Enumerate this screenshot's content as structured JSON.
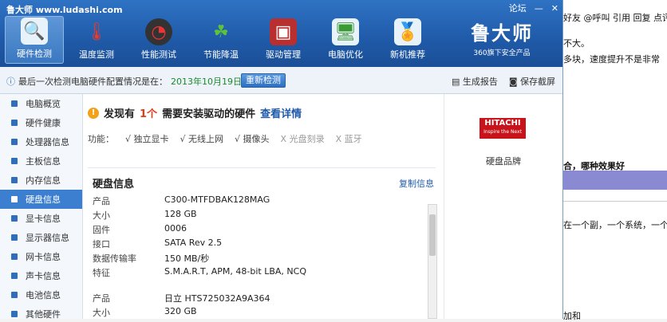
{
  "window": {
    "title": "鲁大师 www.ludashi.com",
    "forum_label": "论坛"
  },
  "toolbar": {
    "items": [
      {
        "label": "硬件检测",
        "icon": "monitor-magnifier-icon"
      },
      {
        "label": "温度监测",
        "icon": "thermometer-icon"
      },
      {
        "label": "性能测试",
        "icon": "speedometer-icon"
      },
      {
        "label": "节能降温",
        "icon": "clover-icon"
      },
      {
        "label": "驱动管理",
        "icon": "driver-box-icon"
      },
      {
        "label": "电脑优化",
        "icon": "monitor-broom-icon"
      },
      {
        "label": "新机推荐",
        "icon": "monitor-badge-icon"
      }
    ]
  },
  "brand": {
    "logo": "鲁大师",
    "slogan": "360旗下安全产品"
  },
  "status": {
    "text": "最后一次检测电脑硬件配置情况是在：",
    "date": "2013年10月19日",
    "recheck_label": "重新检测",
    "report_label": "生成报告",
    "screenshot_label": "保存截屏"
  },
  "sidebar": {
    "items": [
      {
        "label": "电脑概览"
      },
      {
        "label": "硬件健康"
      },
      {
        "label": "处理器信息"
      },
      {
        "label": "主板信息"
      },
      {
        "label": "内存信息"
      },
      {
        "label": "硬盘信息"
      },
      {
        "label": "显卡信息"
      },
      {
        "label": "显示器信息"
      },
      {
        "label": "网卡信息"
      },
      {
        "label": "声卡信息"
      },
      {
        "label": "电池信息"
      },
      {
        "label": "其他硬件"
      }
    ],
    "active_index": 5
  },
  "main": {
    "alert_prefix": "发现有",
    "alert_count": "1个",
    "alert_suffix": "需要安装驱动的硬件",
    "alert_link": "查看详情",
    "features_label": "功能：",
    "features": [
      {
        "label": "√ 独立显卡",
        "enabled": true
      },
      {
        "label": "√ 无线上网",
        "enabled": true
      },
      {
        "label": "√ 摄像头",
        "enabled": true
      },
      {
        "label": "X 光盘刻录",
        "enabled": false
      },
      {
        "label": "X 蓝牙",
        "enabled": false
      }
    ],
    "section_title": "硬盘信息",
    "copy_label": "复制信息",
    "disk1": [
      {
        "k": "产品",
        "v": "C300-MTFDBAK128MAG"
      },
      {
        "k": "大小",
        "v": "128 GB"
      },
      {
        "k": "固件",
        "v": "0006"
      },
      {
        "k": "接口",
        "v": "SATA Rev 2.5"
      },
      {
        "k": "数据传输率",
        "v": "150 MB/秒"
      },
      {
        "k": "特征",
        "v": "S.M.A.R.T, APM, 48-bit LBA, NCQ"
      }
    ],
    "disk2": [
      {
        "k": "产品",
        "v": "日立  HTS725032A9A364"
      },
      {
        "k": "大小",
        "v": "320 GB"
      }
    ]
  },
  "rightpanel": {
    "logo_text": "HITACHI",
    "logo_tagline": "Inspire the Next",
    "brand_label": "硬盘品牌"
  },
  "background_page": {
    "top_links": "好友 @呼叫  引用 回复 点评",
    "lines": [
      "不大。",
      "多块，速度提升不是非常",
      "合，哪种效果好",
      "在一个副，一个系统，一个资",
      "加和"
    ]
  }
}
